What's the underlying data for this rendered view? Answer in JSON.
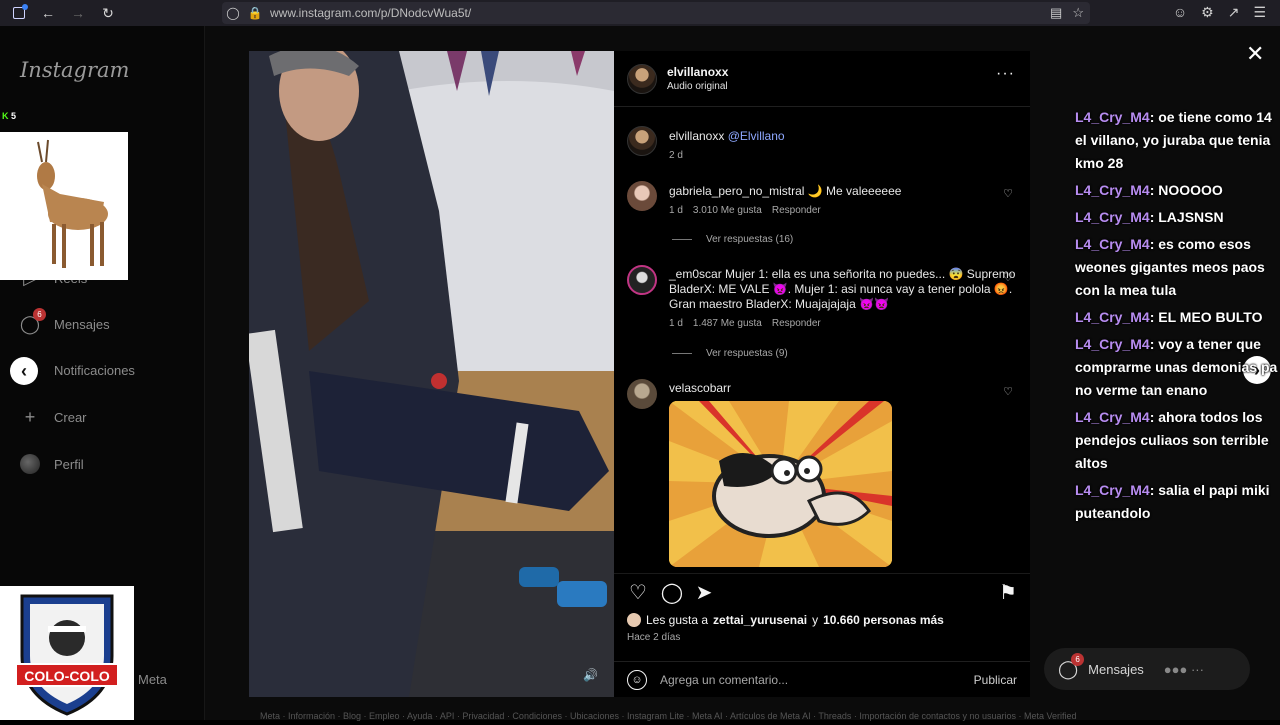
{
  "browser": {
    "url": "www.instagram.com/p/DNodcvWua5t/"
  },
  "sidebar": {
    "logo": "Instagram",
    "items": [
      {
        "label": "Reels",
        "icon": "reels-icon"
      },
      {
        "label": "Mensajes",
        "icon": "messenger-icon",
        "badge": "6"
      },
      {
        "label": "Notificaciones",
        "icon": "heart-icon"
      },
      {
        "label": "Crear",
        "icon": "plus-icon"
      },
      {
        "label": "Perfil",
        "icon": "avatar-icon"
      }
    ],
    "meta": "Meta"
  },
  "overlay": {
    "kick_count": "5",
    "team_name": "COLO-COLO"
  },
  "post": {
    "author": "elvillanoxx",
    "audio": "Audio original",
    "caption_user": "elvillanoxx",
    "caption_mention": "@Elvillano",
    "caption_age": "2 d",
    "comments": [
      {
        "user": "gabriela_pero_no_mistral",
        "text": "🌙 Me valeeeeee",
        "age": "1 d",
        "likes": "3.010 Me gusta",
        "reply": "Responder",
        "view_replies": "Ver respuestas (16)"
      },
      {
        "user": "_em0scar",
        "text": "Mujer 1: ella es una señorita no puedes... 😨 Supremo BladerX: ME VALE 👿. Mujer 1: asi nunca vay a tener polola 😡. Gran maestro BladerX: Muajajajaja 👿👿",
        "age": "1 d",
        "likes": "1.487 Me gusta",
        "reply": "Responder",
        "view_replies": "Ver respuestas (9)"
      },
      {
        "user": "velascobarr",
        "text": ""
      }
    ],
    "likes_prefix": "Les gusta a",
    "likes_user": "zettai_yurusenai",
    "likes_and": "y",
    "likes_others": "10.660 personas más",
    "posted_ago": "Hace 2 días",
    "comment_placeholder": "Agrega un comentario...",
    "publish_label": "Publicar"
  },
  "chat": [
    {
      "who": "L4_Cry_M4",
      "text": ": oe tiene como 14 el villano, yo juraba que tenia kmo 28"
    },
    {
      "who": "L4_Cry_M4",
      "text": ": NOOOOO"
    },
    {
      "who": "L4_Cry_M4",
      "text": ": LAJSNSN"
    },
    {
      "who": "L4_Cry_M4",
      "text": ": es como esos weones gigantes meos paos con la mea tula"
    },
    {
      "who": "L4_Cry_M4",
      "text": ": EL MEO BULTO"
    },
    {
      "who": "L4_Cry_M4",
      "text": ": voy a tener que comprarme unas demonias pa no verme tan enano"
    },
    {
      "who": "L4_Cry_M4",
      "text": ": ahora todos los pendejos culiaos son terrible altos"
    },
    {
      "who": "L4_Cry_M4",
      "text": ": salia el papi miki puteandolo"
    }
  ],
  "dm": {
    "label": "Mensajes",
    "badge": "6"
  },
  "footer": "Meta · Información · Blog · Empleo · Ayuda · API · Privacidad · Condiciones · Ubicaciones · Instagram Lite · Meta AI · Artículos de Meta AI · Threads · Importación de contactos y no usuarios · Meta Verified"
}
